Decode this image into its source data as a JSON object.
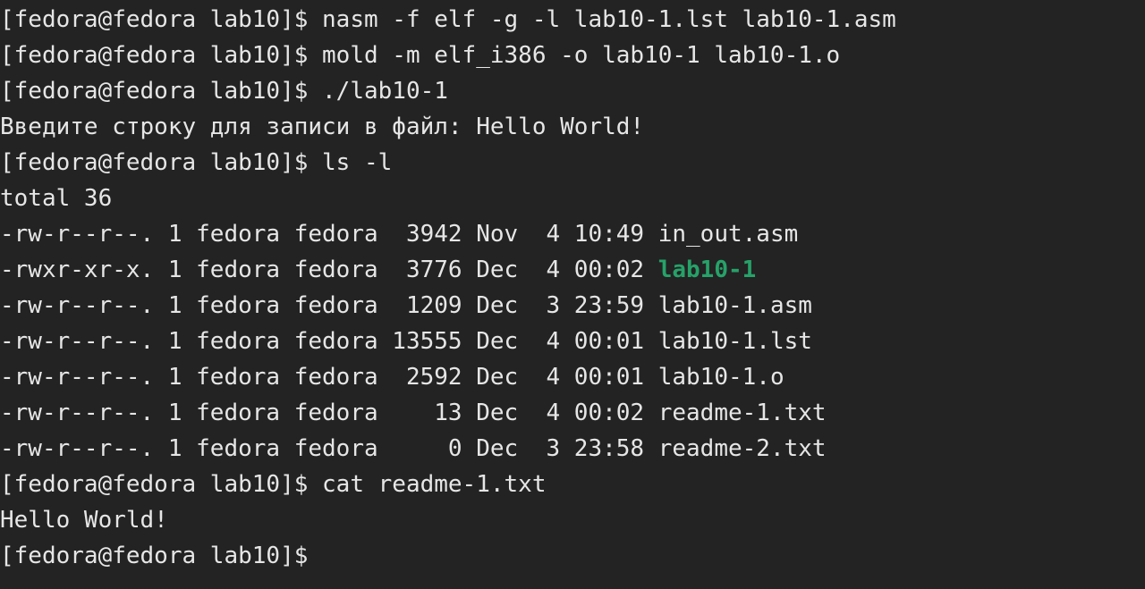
{
  "terminal": {
    "lines": [
      "[fedora@fedora lab10]$ nasm -f elf -g -l lab10-1.lst lab10-1.asm",
      "[fedora@fedora lab10]$ mold -m elf_i386 -o lab10-1 lab10-1.o",
      "[fedora@fedora lab10]$ ./lab10-1",
      "Введите строку для записи в файл: Hello World!",
      "[fedora@fedora lab10]$ ls -l",
      "total 36"
    ],
    "listing": [
      {
        "meta": "-rw-r--r--. 1 fedora fedora  3942 Nov  4 10:49 ",
        "name": "in_out.asm",
        "type": "file"
      },
      {
        "meta": "-rwxr-xr-x. 1 fedora fedora  3776 Dec  4 00:02 ",
        "name": "lab10-1",
        "type": "executable"
      },
      {
        "meta": "-rw-r--r--. 1 fedora fedora  1209 Dec  3 23:59 ",
        "name": "lab10-1.asm",
        "type": "file"
      },
      {
        "meta": "-rw-r--r--. 1 fedora fedora 13555 Dec  4 00:01 ",
        "name": "lab10-1.lst",
        "type": "file"
      },
      {
        "meta": "-rw-r--r--. 1 fedora fedora  2592 Dec  4 00:01 ",
        "name": "lab10-1.o",
        "type": "file"
      },
      {
        "meta": "-rw-r--r--. 1 fedora fedora    13 Dec  4 00:02 ",
        "name": "readme-1.txt",
        "type": "file"
      },
      {
        "meta": "-rw-r--r--. 1 fedora fedora     0 Dec  3 23:58 ",
        "name": "readme-2.txt",
        "type": "file"
      }
    ],
    "after": [
      "[fedora@fedora lab10]$ cat readme-1.txt",
      "Hello World!"
    ],
    "prompt": "[fedora@fedora lab10]$",
    "colors": {
      "background": "#232323",
      "foreground": "#e6e6e6",
      "executable": "#26a269"
    }
  }
}
